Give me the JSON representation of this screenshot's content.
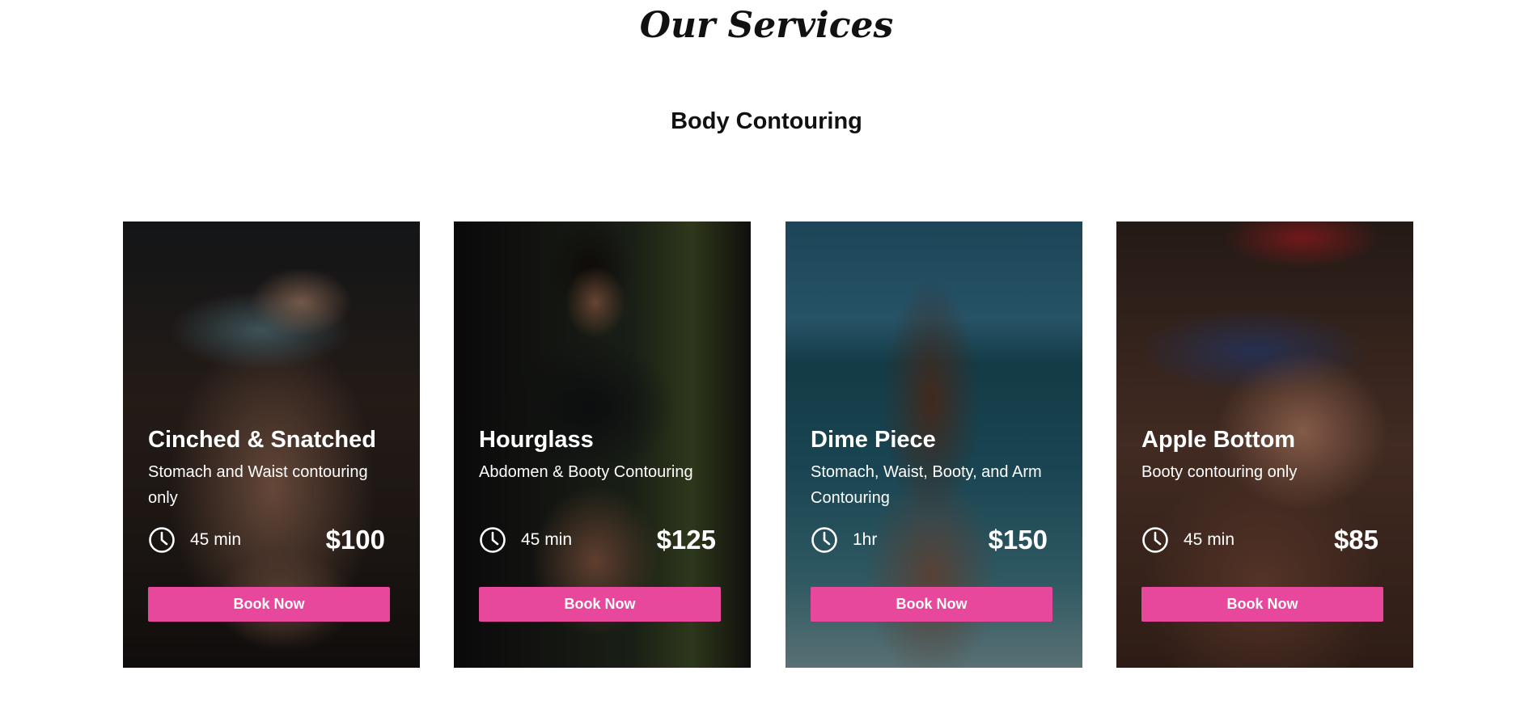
{
  "page": {
    "title": "Our Services",
    "subtitle": "Body Contouring"
  },
  "colors": {
    "accent": "#e8489b",
    "text_dark": "#111111",
    "text_light": "#ffffff"
  },
  "services": [
    {
      "title": "Cinched & Snatched",
      "description": "Stomach and Waist contouring only",
      "duration": "45 min",
      "price": "$100",
      "button_label": "Book Now",
      "icon": "clock-icon"
    },
    {
      "title": "Hourglass",
      "description": "Abdomen & Booty Contouring",
      "duration": "45 min",
      "price": "$125",
      "button_label": "Book Now",
      "icon": "clock-icon"
    },
    {
      "title": "Dime Piece",
      "description": "Stomach, Waist, Booty, and Arm Contouring",
      "duration": "1hr",
      "price": "$150",
      "button_label": "Book Now",
      "icon": "clock-icon"
    },
    {
      "title": "Apple Bottom",
      "description": "Booty contouring only",
      "duration": "45 min",
      "price": "$85",
      "button_label": "Book Now",
      "icon": "clock-icon"
    }
  ]
}
